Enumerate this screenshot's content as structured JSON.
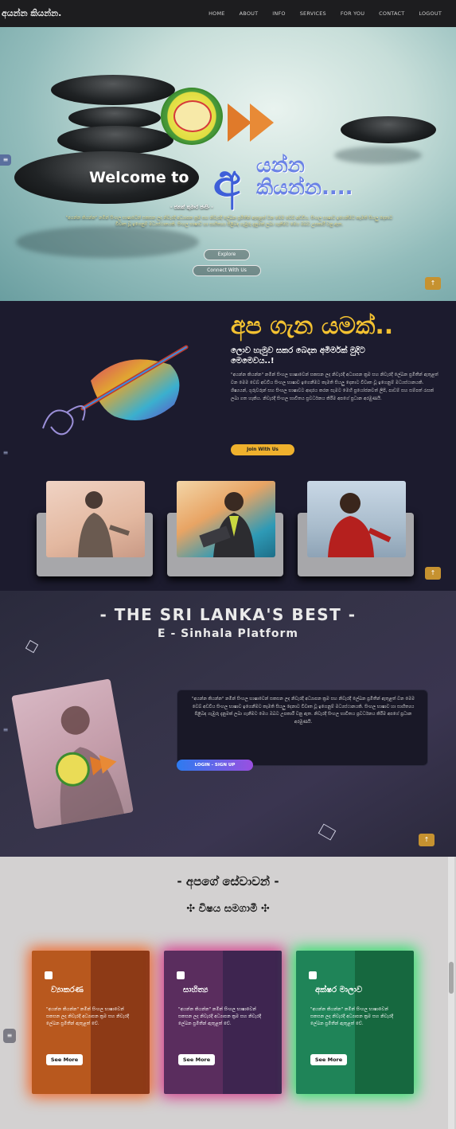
{
  "nav": {
    "brand": "අයන්න කියන්න.",
    "items": [
      "HOME",
      "ABOUT",
      "INFO",
      "SERVICES",
      "FOR YOU",
      "CONTACT",
      "LOGOUT"
    ]
  },
  "hero": {
    "welcome": "Welcome to",
    "brand_letter": "අ",
    "brand_line1": "යන්න",
    "brand_line2": "කියන්න....",
    "subtitle": "- ජනක් කුමාර ජාසිං -",
    "text": "\"අයන්න කියන්න\" නමින් සිංහල භාෂාවෙන් සකසන ලද නිවැරදි අධ්‍යාපන ක්‍රම සහ නිවැරදි ලේඛන ප්‍රමිතීන් ඇතුළත් වන මෙම වෙබ් අඩවිය, සිංහල භාෂාව ඉගෙනීමට කැමති සියලු දෙනාට විවෘත වූ ඉගෙනුම් මධ්‍යස්ථානයකි. සිංහල භාෂාව හා සාහිත්‍යය පිළිබඳ ගැඹුරු දැනුමක් ලබා ගැනීමට මෙය ඔබට උපකාරී වනු ඇත.",
    "explore": "Explore",
    "connect": "Connect With Us"
  },
  "about": {
    "title": "අප ගැන යමක්..",
    "subtitle": "ලොව හැමුව සකර බෙදන අමිර්මක් මුදිට මෙමෙවය..!",
    "text": "\"අයන්න කියන්න\" නමින් සිංහල භාෂාවෙන් සකසන ලද නිවැරදි අධ්‍යාපන ක්‍රම සහ නිවැරදි ලේඛන ප්‍රමිතීන් ඇතුළත් වන මෙම වෙබ් අඩවිය සිංහල භාෂාව ඉගෙනීමට කැමති සියලු දෙනාට විවෘත වූ ඉගෙනුම් මධ්‍යස්ථානයකි. ශිෂ්‍යයන්, ගුරුවරුන් සහ සිංහල භාෂාවට ආදරය කරන සැමට මෙහි ප්‍රයෝජනවත් ලිපි, පාඩම් සහ සම්පත් රැසක් ලබා ගත හැකිය. නිවැරදි සිංහල භාවිතය ප්‍රවර්ධනය කිරීම අපගේ ප්‍රධාන අරමුණයි.",
    "join": "Join With Us"
  },
  "platform": {
    "title": "- THE SRI LANKA'S BEST -",
    "subtitle": "E - Sinhala Platform",
    "text": "\"අයන්න කියන්න\" නමින් සිංහල භාෂාවෙන් සකසන ලද නිවැරදි අධ්‍යාපන ක්‍රම සහ නිවැරදි ලේඛන ප්‍රමිතීන් ඇතුළත් වන මෙම වෙබ් අඩවිය සිංහල භාෂාව ඉගෙනීමට කැමති සියලු දෙනාට විවෘත වූ ඉගෙනුම් මධ්‍යස්ථානයකි. සිංහල භාෂාව හා සාහිත්‍යය පිළිබඳ ගැඹුරු දැනුමක් ලබා ගැනීමට මෙය ඔබට උපකාරී වනු ඇත. නිවැරදි සිංහල භාවිතය ප්‍රවර්ධනය කිරීම අපගේ ප්‍රධාන අරමුණයි.",
    "login": "LOGIN - SIGN UP"
  },
  "services": {
    "title": "- අපගේ සේවාවන් -",
    "subtitle": "✣ විෂය සමගාමී ✣",
    "cards": [
      {
        "name": "ව්‍යාකරණ",
        "text": "\"අයන්න කියන්න\" නමින් සිංහල භාෂාවෙන් සකසන ලද නිවැරදි අධ්‍යාපන ක්‍රම සහ නිවැරදි ලේඛන ප්‍රමිතීන් ඇතුළත් වේ.",
        "button": "See More"
      },
      {
        "name": "සාහිත්‍ය",
        "text": "\"අයන්න කියන්න\" නමින් සිංහල භාෂාවෙන් සකසන ලද නිවැරදි අධ්‍යාපන ක්‍රම සහ නිවැරදි ලේඛන ප්‍රමිතීන් ඇතුළත් වේ.",
        "button": "See More"
      },
      {
        "name": "අක්ෂර මාලාව",
        "text": "\"අයන්න කියන්න\" නමින් සිංහල භාෂාවෙන් සකසන ලද නිවැරදි අධ්‍යාපන ක්‍රම සහ නිවැරදි ලේඛන ප්‍රමිතීන් ඇතුළත් වේ.",
        "button": "See More"
      }
    ]
  },
  "icons": {
    "menu": "hamburger-icon",
    "top": "arrow-up-icon",
    "service": "document-icon"
  },
  "colors": {
    "accent": "#f3c131",
    "nav_bg": "#1d1d1f",
    "about_bg": "#1c1b2e",
    "services_bg": "#d3d1d1"
  }
}
